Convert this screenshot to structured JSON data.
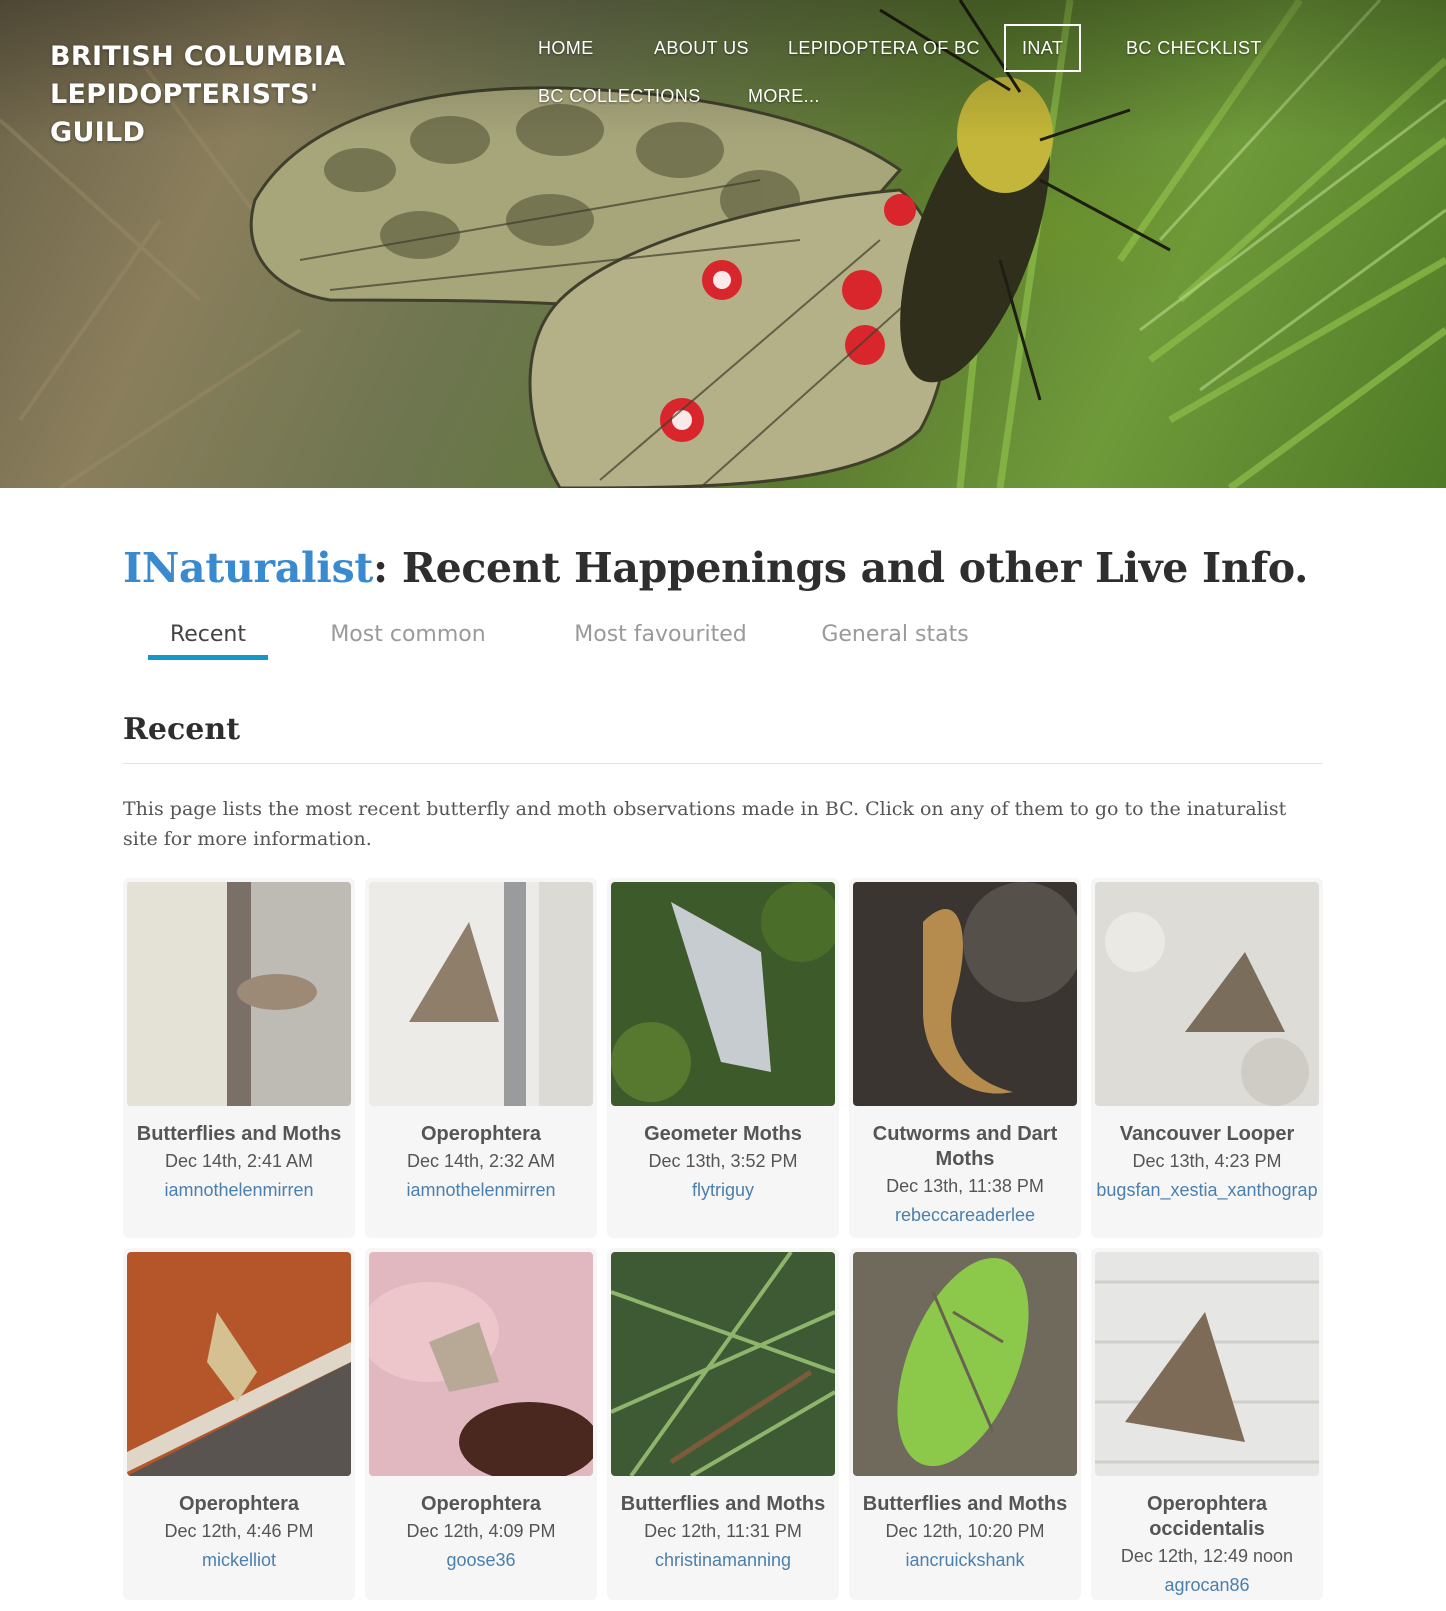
{
  "site": {
    "title_line1": "BRITISH COLUMBIA",
    "title_line2": "LEPIDOPTERISTS' GUILD"
  },
  "nav": {
    "items": [
      {
        "label": "HOME"
      },
      {
        "label": "ABOUT US"
      },
      {
        "label": "LEPIDOPTERA OF BC"
      },
      {
        "label": "INAT",
        "active": true
      },
      {
        "label": "BC CHECKLIST"
      },
      {
        "label": "BC COLLECTIONS"
      },
      {
        "label": "MORE..."
      }
    ]
  },
  "page": {
    "heading_brand": "INaturalist",
    "heading_rest": ": Recent Happenings and other Live Info.",
    "brand_color": "#3a8ad0",
    "tab_accent_color": "#1597c9",
    "tabs": [
      {
        "label": "Recent",
        "active": true
      },
      {
        "label": "Most common"
      },
      {
        "label": "Most favourited"
      },
      {
        "label": "General stats"
      }
    ],
    "section_title": "Recent",
    "intro": "This page lists the most recent butterfly and moth observations made in BC. Click on any of them to go to the inaturalist site for more information."
  },
  "observations": [
    {
      "name": "Butterflies and Moths",
      "date": "Dec 14th, 2:41 AM",
      "user": "iamnothelenmirren"
    },
    {
      "name": "Operophtera",
      "date": "Dec 14th, 2:32 AM",
      "user": "iamnothelenmirren"
    },
    {
      "name": "Geometer Moths",
      "date": "Dec 13th, 3:52 PM",
      "user": "flytriguy"
    },
    {
      "name": "Cutworms and Dart Moths",
      "date": "Dec 13th, 11:38 PM",
      "user": "rebeccareaderlee"
    },
    {
      "name": "Vancouver Looper",
      "date": "Dec 13th, 4:23 PM",
      "user": "bugsfan_xestia_xanthograp"
    },
    {
      "name": "Operophtera",
      "date": "Dec 12th, 4:46 PM",
      "user": "mickelliot"
    },
    {
      "name": "Operophtera",
      "date": "Dec 12th, 4:09 PM",
      "user": "goose36"
    },
    {
      "name": "Butterflies and Moths",
      "date": "Dec 12th, 11:31 PM",
      "user": "christinamanning"
    },
    {
      "name": "Butterflies and Moths",
      "date": "Dec 12th, 10:20 PM",
      "user": "iancruickshank"
    },
    {
      "name": "Operophtera occidentalis",
      "date": "Dec 12th, 12:49 noon",
      "user": "agrocan86"
    }
  ]
}
